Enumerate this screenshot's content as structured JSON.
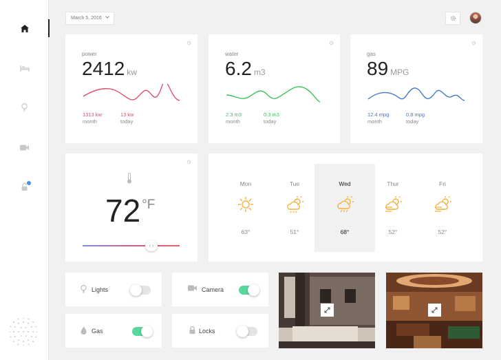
{
  "header": {
    "date": "March 5, 2016"
  },
  "sidebar": {
    "items": [
      "home-icon",
      "bed-icon",
      "bulb-icon",
      "camera-icon",
      "lock-icon"
    ]
  },
  "metrics": [
    {
      "label": "power",
      "value": "2412",
      "unit": "kw",
      "color": "#d9506a",
      "stats": [
        {
          "value": "1313 kw",
          "label": "month"
        },
        {
          "value": "13 kw",
          "label": "today"
        }
      ]
    },
    {
      "label": "water",
      "value": "6.2",
      "unit": "m3",
      "color": "#3ec15a",
      "stats": [
        {
          "value": "2.3 m3",
          "label": "month"
        },
        {
          "value": "0.3 m3",
          "label": "today"
        }
      ]
    },
    {
      "label": "gas",
      "value": "89",
      "unit": "MPG",
      "color": "#3e79c9",
      "stats": [
        {
          "value": "12.4 mpg",
          "label": "month"
        },
        {
          "value": "0.8 mpg",
          "label": "today"
        }
      ]
    }
  ],
  "thermostat": {
    "value": "72",
    "unit": "°F",
    "slider_label": "‹ ›"
  },
  "weather": [
    {
      "day": "Mon",
      "temp": "63°",
      "icon": "sun-icon"
    },
    {
      "day": "Tue",
      "temp": "51°",
      "icon": "partly-cloudy-icon"
    },
    {
      "day": "Wed",
      "temp": "68°",
      "icon": "rain-cloud-icon",
      "selected": true
    },
    {
      "day": "Thur",
      "temp": "52°",
      "icon": "windy-sun-icon"
    },
    {
      "day": "Fri",
      "temp": "52°",
      "icon": "windy-sun-icon"
    }
  ],
  "controls": [
    {
      "label": "Lights",
      "on": false,
      "icon": "bulb-icon"
    },
    {
      "label": "Camera",
      "on": true,
      "icon": "camera-icon"
    },
    {
      "label": "Gas",
      "on": true,
      "icon": "flame-icon"
    },
    {
      "label": "Locks",
      "on": false,
      "icon": "lock-icon"
    }
  ],
  "colors": {
    "toggle_on": "#58d89c",
    "weather_icon": "#f5b13d",
    "notification": "#4a90e2"
  }
}
